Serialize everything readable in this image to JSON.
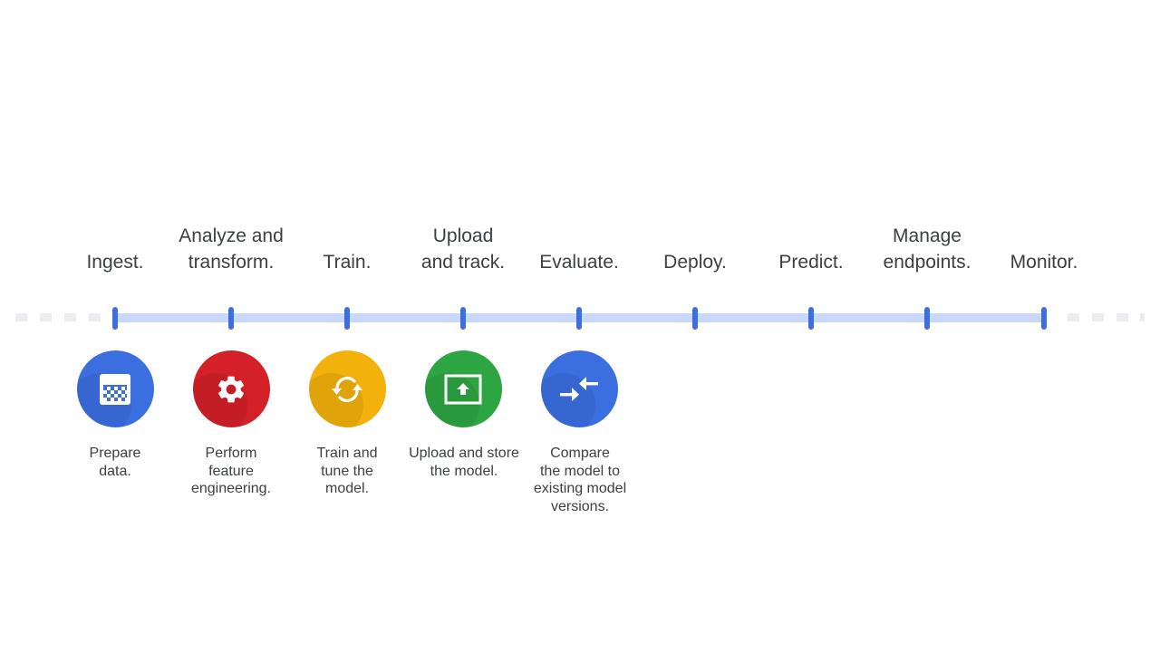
{
  "stages": [
    {
      "label": "Ingest."
    },
    {
      "label": "Analyze and transform."
    },
    {
      "label": "Train."
    },
    {
      "label": "Upload and track."
    },
    {
      "label": "Evaluate."
    },
    {
      "label": "Deploy."
    },
    {
      "label": "Predict."
    },
    {
      "label": "Manage endpoints."
    },
    {
      "label": "Monitor."
    }
  ],
  "stage_labels_lines": [
    [
      "Ingest."
    ],
    [
      "Analyze and",
      "transform."
    ],
    [
      "Train."
    ],
    [
      "Upload",
      "and track."
    ],
    [
      "Evaluate."
    ],
    [
      "Deploy."
    ],
    [
      "Predict."
    ],
    [
      "Manage",
      "endpoints."
    ],
    [
      "Monitor."
    ]
  ],
  "steps": [
    {
      "icon": "prepare-data-icon",
      "color": "#3b6fe0",
      "description_lines": [
        "Prepare",
        "data."
      ]
    },
    {
      "icon": "gear-icon",
      "color": "#d32029",
      "description_lines": [
        "Perform",
        "feature",
        "engineering."
      ]
    },
    {
      "icon": "sync-icon",
      "color": "#f2b10b",
      "description_lines": [
        "Train and",
        "tune the",
        "model."
      ]
    },
    {
      "icon": "upload-icon",
      "color": "#2ea543",
      "description_lines": [
        "Upload and store",
        "the model."
      ]
    },
    {
      "icon": "compare-arrows-icon",
      "color": "#3b6fe0",
      "description_lines": [
        "Compare",
        "the model to",
        "existing model",
        "versions."
      ]
    }
  ],
  "colors": {
    "track": "#c9d8f8",
    "tick": "#3b6fe0",
    "dash": "#ebedf0"
  }
}
